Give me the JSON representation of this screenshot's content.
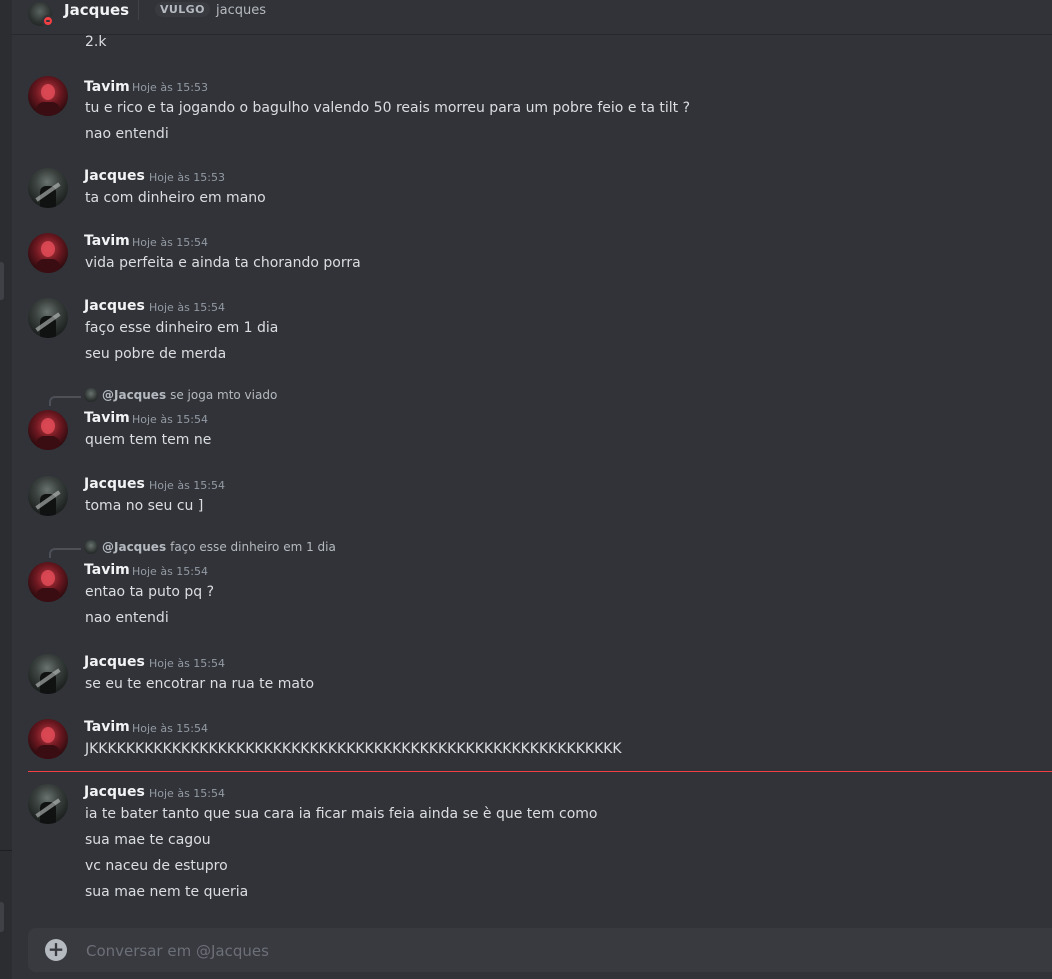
{
  "header": {
    "title": "Jacques",
    "tag": "VULGO",
    "username": "jacques"
  },
  "continuation": {
    "text": "2.k"
  },
  "messages": [
    {
      "author": "Tavim",
      "time": "Hoje às 15:53",
      "lines": [
        "tu e rico e ta jogando o bagulho valendo 50 reais morreu para um pobre feio e ta tilt ?",
        "nao entendi"
      ]
    },
    {
      "author": "Jacques",
      "time": "Hoje às 15:53",
      "lines": [
        "ta com dinheiro em mano"
      ]
    },
    {
      "author": "Tavim",
      "time": "Hoje às 15:54",
      "lines": [
        "vida perfeita e ainda ta chorando porra"
      ]
    },
    {
      "author": "Jacques",
      "time": "Hoje às 15:54",
      "lines": [
        "faço esse dinheiro em 1 dia",
        "seu pobre de merda"
      ]
    },
    {
      "author": "Tavim",
      "time": "Hoje às 15:54",
      "reply": {
        "name": "@Jacques",
        "text": "se joga mto viado"
      },
      "lines": [
        "quem tem tem ne"
      ]
    },
    {
      "author": "Jacques",
      "time": "Hoje às 15:54",
      "lines": [
        "toma no seu cu ]"
      ]
    },
    {
      "author": "Tavim",
      "time": "Hoje às 15:54",
      "reply": {
        "name": "@Jacques",
        "text": "faço esse dinheiro em 1 dia"
      },
      "lines": [
        "entao ta puto pq ?",
        "nao entendi"
      ]
    },
    {
      "author": "Jacques",
      "time": "Hoje às 15:54",
      "lines": [
        "se eu te encotrar na rua te mato"
      ]
    },
    {
      "author": "Tavim",
      "time": "Hoje às 15:54",
      "lines": [
        "JKKKKKKKKKKKKKKKKKKKKKKKKKKKKKKKKKKKKKKKKKKKKKKKKKKKKKKKKKK"
      ]
    },
    {
      "author": "Jacques",
      "time": "Hoje às 15:54",
      "lines": [
        "ia te bater tanto que sua cara ia ficar mais feia ainda se è que tem como",
        "sua mae te cagou",
        "vc naceu de estupro",
        "sua mae nem te queria"
      ]
    }
  ],
  "composer": {
    "placeholder": "Conversar em @Jacques"
  },
  "colors": {
    "background": "#313338",
    "new_messages_divider": "#f23f43"
  }
}
